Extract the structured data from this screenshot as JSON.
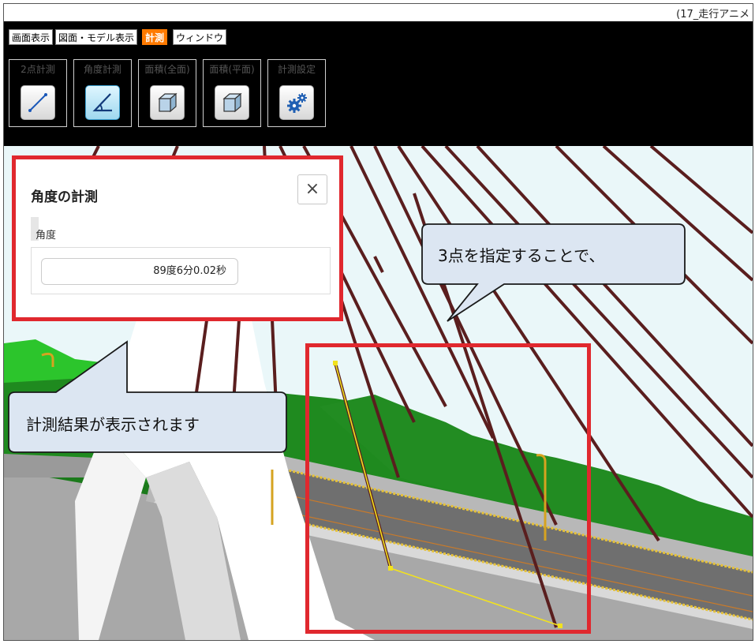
{
  "window": {
    "title": "(17_走行アニメ"
  },
  "menu": {
    "items": [
      "画面表示",
      "図面・モデル表示",
      "計測",
      "ウィンドウ"
    ],
    "active_index": 2
  },
  "tools": [
    {
      "label": "2点計測",
      "icon": "line-measure-icon"
    },
    {
      "label": "角度計測",
      "icon": "angle-measure-icon",
      "selected": true
    },
    {
      "label": "面積(全面)",
      "icon": "cube-icon"
    },
    {
      "label": "面積(平面)",
      "icon": "cube-icon"
    },
    {
      "label": "計測設定",
      "icon": "gear-icon"
    }
  ],
  "panel": {
    "title": "角度の計測",
    "close_label": "×",
    "field_label": "角度",
    "field_value": "89度6分0.02秒"
  },
  "callouts": {
    "top": "3点を指定することで、",
    "bottom": "計測結果が表示されます"
  },
  "colors": {
    "highlight": "#e0282e",
    "active_menu": "#ff7a00",
    "cable": "#5a1e1e",
    "sky": "#e9f6f8",
    "grass": "#1f8a1f"
  }
}
